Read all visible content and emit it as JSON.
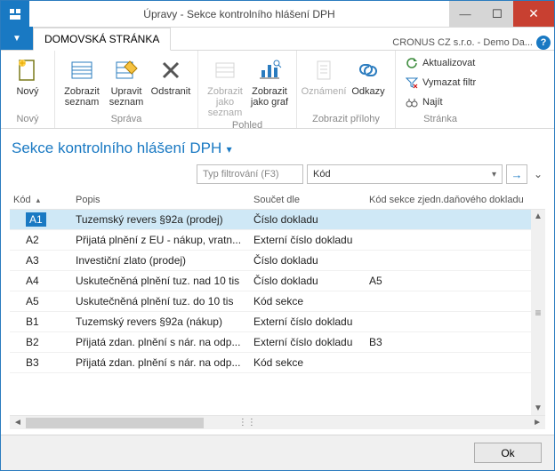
{
  "window": {
    "title": "Úpravy - Sekce kontrolního hlášení DPH",
    "company": "CRONUS CZ s.r.o. - Demo Da..."
  },
  "tabs": {
    "home": "DOMOVSKÁ STRÁNKA"
  },
  "ribbon": {
    "groups": {
      "novy": "Nový",
      "sprava": "Správa",
      "pohled": "Pohled",
      "prilohy": "Zobrazit přílohy",
      "stranka": "Stránka"
    },
    "buttons": {
      "novy": "Nový",
      "zobrazit_seznam": "Zobrazit\nseznam",
      "upravit_seznam": "Upravit\nseznam",
      "odstranit": "Odstranit",
      "zobrazit_jako_seznam": "Zobrazit jako\nseznam",
      "zobrazit_jako_graf": "Zobrazit\njako graf",
      "oznameni": "Oznámení",
      "odkazy": "Odkazy",
      "aktualizovat": "Aktualizovat",
      "vymazat_filtr": "Vymazat filtr",
      "najit": "Najít"
    }
  },
  "page": {
    "title": "Sekce kontrolního hlášení DPH"
  },
  "filter": {
    "type_placeholder": "Typ filtrování (F3)",
    "field": "Kód"
  },
  "columns": {
    "kod": "Kód",
    "popis": "Popis",
    "soucet": "Součet dle",
    "sekce": "Kód sekce zjedn.daňového dokladu"
  },
  "rows": [
    {
      "kod": "A1",
      "popis": "Tuzemský revers §92a (prodej)",
      "soucet": "Číslo dokladu",
      "sekce": ""
    },
    {
      "kod": "A2",
      "popis": "Přijatá plnění z EU - nákup, vratn...",
      "soucet": "Externí číslo dokladu",
      "sekce": ""
    },
    {
      "kod": "A3",
      "popis": "Investiční zlato (prodej)",
      "soucet": "Číslo dokladu",
      "sekce": ""
    },
    {
      "kod": "A4",
      "popis": "Uskutečněná plnění tuz. nad 10 tis",
      "soucet": "Číslo dokladu",
      "sekce": "A5"
    },
    {
      "kod": "A5",
      "popis": "Uskutečněná plnění tuz. do 10 tis",
      "soucet": "Kód sekce",
      "sekce": ""
    },
    {
      "kod": "B1",
      "popis": "Tuzemský revers §92a (nákup)",
      "soucet": "Externí číslo dokladu",
      "sekce": ""
    },
    {
      "kod": "B2",
      "popis": "Přijatá zdan. plnění s nár. na odp...",
      "soucet": "Externí číslo dokladu",
      "sekce": "B3"
    },
    {
      "kod": "B3",
      "popis": "Přijatá zdan. plnění s nár. na odp...",
      "soucet": "Kód sekce",
      "sekce": ""
    }
  ],
  "footer": {
    "ok": "Ok"
  }
}
